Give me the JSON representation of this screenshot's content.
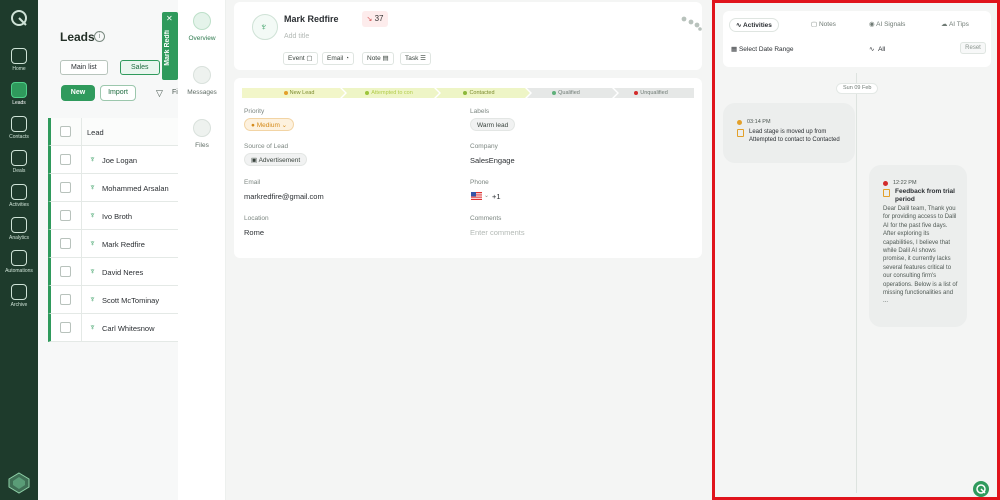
{
  "rail": {
    "items": [
      {
        "label": "Home",
        "icon": "home-icon"
      },
      {
        "label": "Leads",
        "icon": "leads-icon",
        "active": true
      },
      {
        "label": "Contacts",
        "icon": "contacts-icon"
      },
      {
        "label": "Deals",
        "icon": "deals-icon"
      },
      {
        "label": "Activities",
        "icon": "activities-icon"
      },
      {
        "label": "Analytics",
        "icon": "analytics-icon"
      },
      {
        "label": "Automations",
        "icon": "automations-icon"
      },
      {
        "label": "Archive",
        "icon": "archive-icon"
      }
    ]
  },
  "leads": {
    "title": "Leads",
    "tabs": [
      "Main list",
      "Sales"
    ],
    "new_label": "New",
    "import_label": "Import",
    "filter_label": "Fi",
    "header": "Lead",
    "rows": [
      "Joe Logan",
      "Mohammed Arsalan",
      "Ivo Broth",
      "Mark Redfire",
      "David Neres",
      "Scott McTominay",
      "Carl Whitesnow"
    ],
    "open_tab_label": "Mark Redfi"
  },
  "subnav": {
    "items": [
      "Overview",
      "Messages",
      "Files"
    ]
  },
  "detail": {
    "name": "Mark Redfire",
    "score": "37",
    "add_title_placeholder": "Add title",
    "actions": [
      "Event",
      "Email",
      "Note",
      "Task"
    ],
    "stages": [
      "New Lead",
      "Attempted to con",
      "Contacted",
      "Qualified",
      "Unqualified"
    ],
    "priority_label": "Priority",
    "priority_value": "Medium",
    "labels_label": "Labels",
    "labels_value": "Warm lead",
    "source_label": "Source of Lead",
    "source_value": "Advertisement",
    "company_label": "Company",
    "company_value": "SalesEngage",
    "email_label": "Email",
    "email_value": "markredfire@gmail.com",
    "phone_label": "Phone",
    "phone_value": "+1",
    "location_label": "Location",
    "location_value": "Rome",
    "comments_label": "Comments",
    "comments_placeholder": "Enter comments"
  },
  "activity": {
    "tabs": [
      "Activities",
      "Notes",
      "AI Signals",
      "AI Tips"
    ],
    "date_range_label": "Select Date Range",
    "all_label": "All",
    "reset_label": "Reset",
    "day": "Sun 09 Feb",
    "items": [
      {
        "time": "03:14 PM",
        "title": "Lead stage is moved up from Attempted to contact to Contacted"
      },
      {
        "time": "12:22 PM",
        "title": "Feedback from trial period",
        "body": "Dear Dalil team, Thank you for providing access to Dalil AI for the past five days. After exploring its capabilities, I believe that while Dalil AI shows promise, it currently lacks several features critical to our consulting firm's operations. Below is a list of missing functionalities and ..."
      }
    ]
  },
  "colors": {
    "brand": "#2f9a5c",
    "rail": "#1e3b2c",
    "highlight": "#e0141c"
  }
}
